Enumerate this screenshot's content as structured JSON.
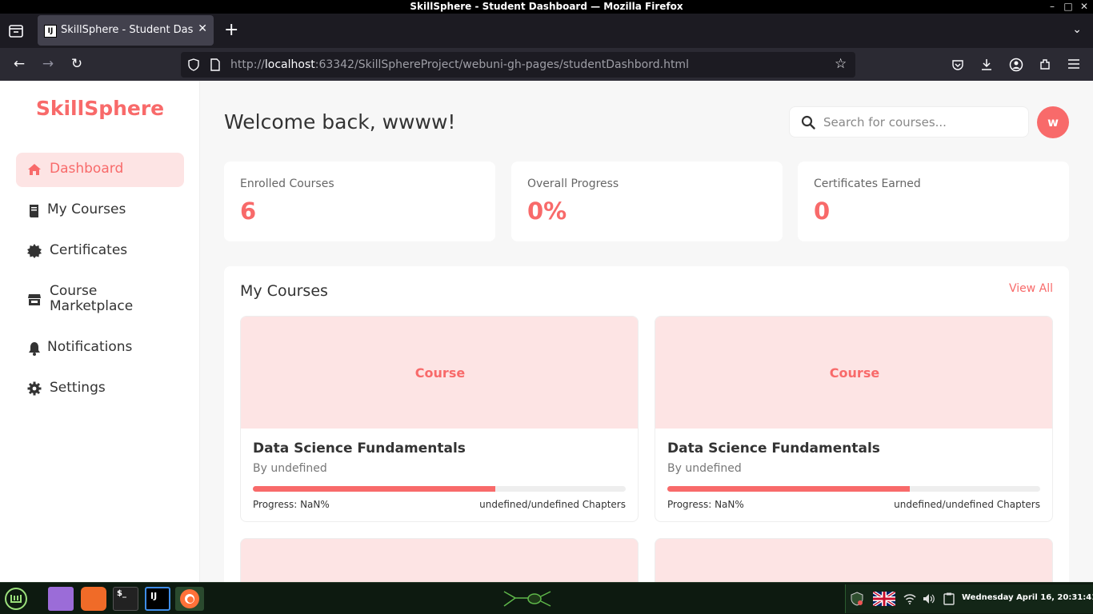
{
  "window": {
    "title": "SkillSphere - Student Dashboard — Mozilla Firefox",
    "controls": [
      "–",
      "□",
      "✕"
    ]
  },
  "browser": {
    "tab_label": "SkillSphere - Student Dashboard",
    "tab_favicon": "IJ",
    "url_scheme": "http://",
    "url_host": "localhost",
    "url_path": ":63342/SkillSphereProject/webuni-gh-pages/studentDashbord.html"
  },
  "sidebar": {
    "brand": "SkillSphere",
    "items": [
      {
        "label": "Dashboard",
        "icon": "home-icon",
        "active": true
      },
      {
        "label": "My Courses",
        "icon": "book-icon",
        "active": false
      },
      {
        "label": "Certificates",
        "icon": "certificate-icon",
        "active": false
      },
      {
        "label": "Course Marketplace",
        "icon": "store-icon",
        "active": false
      },
      {
        "label": "Notifications",
        "icon": "bell-icon",
        "active": false
      },
      {
        "label": "Settings",
        "icon": "gear-icon",
        "active": false
      }
    ]
  },
  "header": {
    "welcome": "Welcome back, wwww!",
    "search_placeholder": "Search for courses...",
    "avatar_initial": "w"
  },
  "stats": [
    {
      "label": "Enrolled Courses",
      "value": "6"
    },
    {
      "label": "Overall Progress",
      "value": "0%"
    },
    {
      "label": "Certificates Earned",
      "value": "0"
    }
  ],
  "courses": {
    "title": "My Courses",
    "view_all": "View All",
    "items": [
      {
        "thumb_label": "Course",
        "title": "Data Science Fundamentals",
        "author": "By undefined",
        "progress_fill": 0.65,
        "progress_text": "Progress: NaN%",
        "chapters": "undefined/undefined Chapters"
      },
      {
        "thumb_label": "Course",
        "title": "Data Science Fundamentals",
        "author": "By undefined",
        "progress_fill": 0.65,
        "progress_text": "Progress: NaN%",
        "chapters": "undefined/undefined Chapters"
      }
    ]
  },
  "taskbar": {
    "clock": "Wednesday April 16, 20:31:41",
    "apps": [
      "mint-menu-icon",
      "files-icon",
      "brave-icon",
      "terminal-icon",
      "intellij-icon",
      "firefox-icon"
    ]
  },
  "colors": {
    "accent": "#f86a6a",
    "accent_light": "#fde4e4"
  }
}
